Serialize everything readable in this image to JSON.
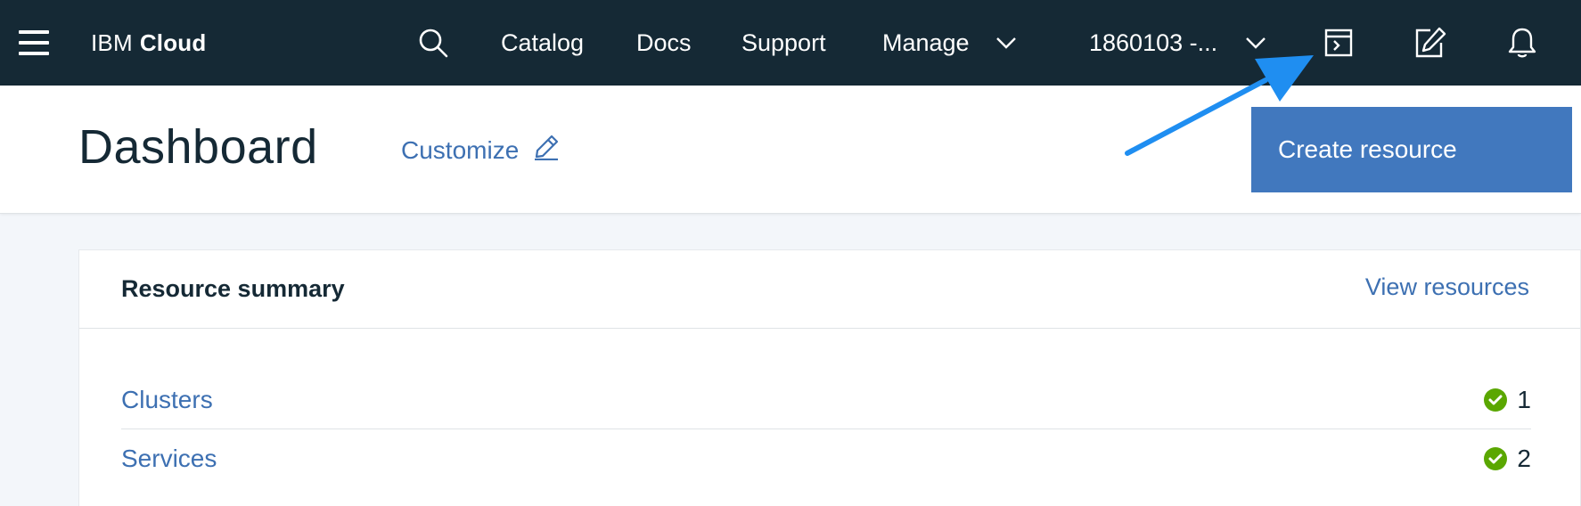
{
  "nav": {
    "brand_prefix": "IBM",
    "brand_name": "Cloud",
    "catalog": "Catalog",
    "docs": "Docs",
    "support": "Support",
    "manage": "Manage",
    "account": "1860103 -..."
  },
  "header": {
    "title": "Dashboard",
    "customize": "Customize",
    "create_button": "Create resource"
  },
  "resource_summary": {
    "title": "Resource summary",
    "view_link": "View resources",
    "rows": [
      {
        "label": "Clusters",
        "count": "1",
        "status_icon": "check-circle-icon"
      },
      {
        "label": "Services",
        "count": "2",
        "status_icon": "check-circle-icon"
      }
    ]
  },
  "colors": {
    "nav_bg": "#152935",
    "primary_button": "#4178be",
    "link": "#3d70b2",
    "status_ok": "#5aa700",
    "annotation_arrow": "#1f8ef1"
  }
}
